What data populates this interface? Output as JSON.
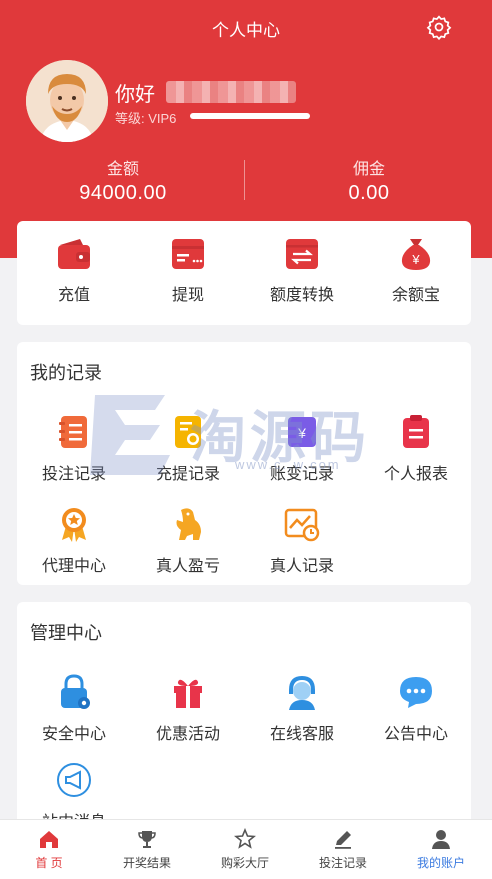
{
  "header": {
    "title": "个人中心",
    "greeting": "你好",
    "level_label": "等级: VIP6",
    "balance_label": "金额",
    "balance_value": "94000.00",
    "commission_label": "佣金",
    "commission_value": "0.00",
    "bg_color": "#e0393b"
  },
  "quick_actions": [
    {
      "label": "充值",
      "icon": "wallet-icon"
    },
    {
      "label": "提现",
      "icon": "card-icon"
    },
    {
      "label": "额度转换",
      "icon": "transfer-icon"
    },
    {
      "label": "余额宝",
      "icon": "money-bag-icon"
    }
  ],
  "records": {
    "title": "我的记录",
    "items": [
      {
        "label": "投注记录",
        "icon": "bet-record-icon"
      },
      {
        "label": "充提记录",
        "icon": "deposit-record-icon"
      },
      {
        "label": "账变记录",
        "icon": "account-change-icon"
      },
      {
        "label": "个人报表",
        "icon": "report-icon"
      },
      {
        "label": "代理中心",
        "icon": "agent-badge-icon"
      },
      {
        "label": "真人盈亏",
        "icon": "dinosaur-icon"
      },
      {
        "label": "真人记录",
        "icon": "chart-record-icon"
      }
    ]
  },
  "management": {
    "title": "管理中心",
    "items": [
      {
        "label": "安全中心",
        "icon": "lock-icon"
      },
      {
        "label": "优惠活动",
        "icon": "gift-icon"
      },
      {
        "label": "在线客服",
        "icon": "service-agent-icon"
      },
      {
        "label": "公告中心",
        "icon": "chat-bubble-icon"
      },
      {
        "label": "站内消息",
        "icon": "megaphone-icon"
      }
    ]
  },
  "watermark": {
    "text": "淘源码",
    "sub": "www.c..w.com"
  },
  "tabbar": [
    {
      "label": "首 页",
      "icon": "home-icon"
    },
    {
      "label": "开奖结果",
      "icon": "trophy-icon"
    },
    {
      "label": "购彩大厅",
      "icon": "star-icon"
    },
    {
      "label": "投注记录",
      "icon": "edit-icon"
    },
    {
      "label": "我的账户",
      "icon": "user-icon"
    }
  ]
}
